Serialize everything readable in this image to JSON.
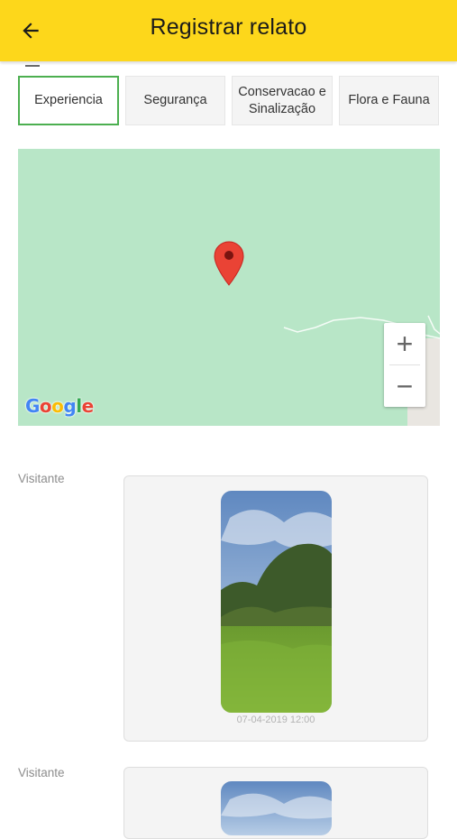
{
  "header": {
    "title": "Registrar relato",
    "back_icon": "arrow-left-icon",
    "color": "#fdd71b"
  },
  "categories": [
    {
      "label": "Experiencia",
      "selected": true
    },
    {
      "label": "Segurança",
      "selected": false
    },
    {
      "label": "Conservacao e Sinalização",
      "selected": false
    },
    {
      "label": "Flora e Fauna",
      "selected": false
    }
  ],
  "map": {
    "zoom_in_label": "+",
    "zoom_out_label": "−",
    "marker_icon": "map-pin-icon",
    "provider": "Google"
  },
  "messages": [
    {
      "author": "Visitante",
      "timestamp": "07-04-2019 12:00",
      "photo_icon": "landscape-photo"
    },
    {
      "author": "Visitante",
      "timestamp": "",
      "photo_icon": "landscape-photo"
    }
  ]
}
